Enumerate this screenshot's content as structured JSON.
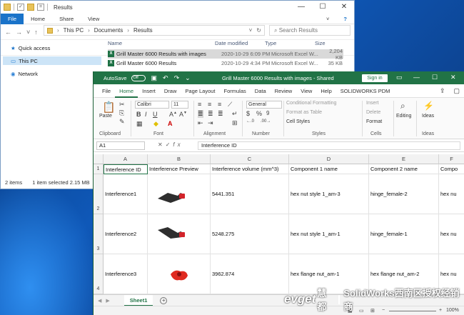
{
  "explorer": {
    "window_title": "Results",
    "ribbon_tabs": [
      "File",
      "Home",
      "Share",
      "View"
    ],
    "breadcrumb": [
      "This PC",
      "Documents",
      "Results"
    ],
    "search_placeholder": "Search Results",
    "columns": [
      "Name",
      "Date modified",
      "Type",
      "Size"
    ],
    "files": [
      {
        "name": "Grill Master 6000 Results with images",
        "date": "2020-10-29 6:09 PM",
        "type": "Microsoft Excel W...",
        "size": "2,204 KB"
      },
      {
        "name": "Grill Master 6000 Results",
        "date": "2020-10-29 4:34 PM",
        "type": "Microsoft Excel W...",
        "size": "35 KB"
      }
    ],
    "nav": [
      "Quick access",
      "This PC",
      "Network"
    ],
    "status_items": "2 items",
    "status_selected": "1 item selected  2.15 MB"
  },
  "excel": {
    "autosave_label": "AutoSave",
    "autosave_state": "Off",
    "doc_title": "Grill Master 6000 Results with images  -  Shared",
    "signin": "Sign in",
    "tabs": [
      "File",
      "Home",
      "Insert",
      "Draw",
      "Page Layout",
      "Formulas",
      "Data",
      "Review",
      "View",
      "Help",
      "SOLIDWORKS PDM"
    ],
    "ribbon": {
      "paste": "Paste",
      "clipboard": "Clipboard",
      "font_name": "Calibri",
      "font_size": "11",
      "font_group": "Font",
      "alignment": "Alignment",
      "number_format": "General",
      "number_group": "Number",
      "cond_format": "Conditional Formatting",
      "format_table": "Format as Table",
      "cell_styles": "Cell Styles",
      "styles_group": "Styles",
      "insert": "Insert",
      "delete": "Delete",
      "format": "Format",
      "cells_group": "Cells",
      "editing": "Editing",
      "ideas": "Ideas",
      "ideas_group": "Ideas"
    },
    "name_box": "A1",
    "formula": "Interference ID",
    "columns": [
      "A",
      "B",
      "C",
      "D",
      "E",
      "F"
    ],
    "header_row": [
      "Interference ID",
      "Interference Preview",
      "Interference volume (mm^3)",
      "Component 1 name",
      "Component 2 name",
      "Compo"
    ],
    "rows": [
      {
        "id": "Interference1",
        "volume": "5441.351",
        "comp1": "hex nut style 1_am-3",
        "comp2": "hinge_female-2",
        "comp3": "hex nu"
      },
      {
        "id": "Interference2",
        "volume": "5248.275",
        "comp1": "hex nut style 1_am-1",
        "comp2": "hinge_female-1",
        "comp3": "hex nu"
      },
      {
        "id": "Interference3",
        "volume": "3962.874",
        "comp1": "hex flange nut_am-1",
        "comp2": "hex flange nut_am-2",
        "comp3": "hex nu"
      }
    ],
    "row_numbers": [
      "1",
      "2",
      "3",
      "4"
    ],
    "sheet": "Sheet1",
    "zoom": "100%"
  },
  "watermark": {
    "brand": "evget",
    "cn1": "慧都",
    "cn2": "SolidWorks西南区授权经销商"
  },
  "colors": {
    "excel_green": "#217346",
    "explorer_accent": "#1a73c9"
  }
}
